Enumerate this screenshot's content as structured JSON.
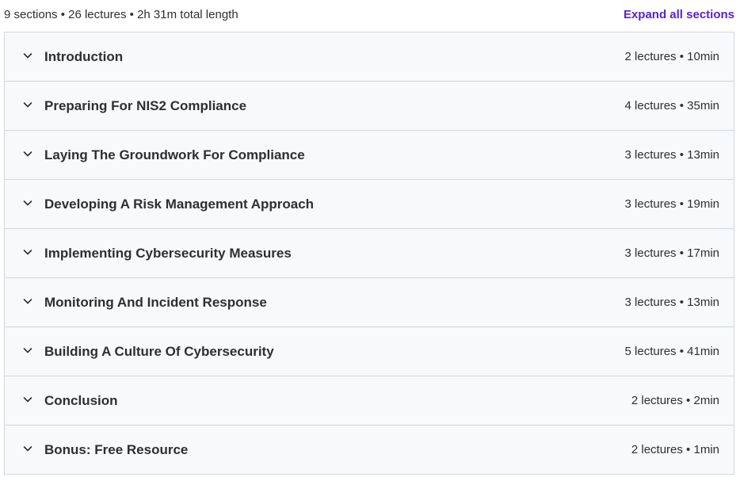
{
  "header": {
    "summary": "9 sections • 26 lectures • 2h 31m total length",
    "expand_label": "Expand all sections"
  },
  "sections": [
    {
      "title": "Introduction",
      "meta": "2 lectures • 10min"
    },
    {
      "title": "Preparing For NIS2 Compliance",
      "meta": "4 lectures • 35min"
    },
    {
      "title": "Laying The Groundwork For Compliance",
      "meta": "3 lectures • 13min"
    },
    {
      "title": "Developing A Risk Management Approach",
      "meta": "3 lectures • 19min"
    },
    {
      "title": "Implementing Cybersecurity Measures",
      "meta": "3 lectures • 17min"
    },
    {
      "title": "Monitoring And Incident Response",
      "meta": "3 lectures • 13min"
    },
    {
      "title": "Building A Culture Of Cybersecurity",
      "meta": "5 lectures • 41min"
    },
    {
      "title": "Conclusion",
      "meta": "2 lectures • 2min"
    },
    {
      "title": "Bonus: Free Resource",
      "meta": "2 lectures • 1min"
    }
  ],
  "icons": {
    "section_toggle": "chevron-down-icon"
  },
  "colors": {
    "accent": "#5624d0",
    "text": "#2d2f31",
    "section_bg": "#f7f9fa",
    "border": "#d1d7dc"
  }
}
